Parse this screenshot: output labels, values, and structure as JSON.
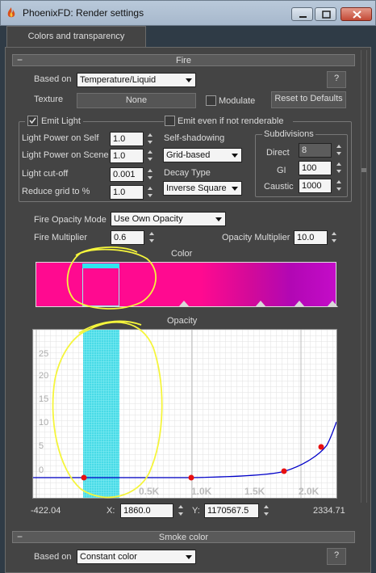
{
  "window": {
    "title": "PhoenixFD: Render settings",
    "app_icon": "phoenix-flame-icon"
  },
  "tabs": [
    {
      "label": "Colors and transparency",
      "active": true
    }
  ],
  "fire_rollout": {
    "header": "Fire",
    "collapse_symbol": "−",
    "based_on_label": "Based on",
    "based_on_value": "Temperature/Liquid",
    "help_label": "?",
    "texture_label": "Texture",
    "texture_value": "None",
    "modulate_label": "Modulate",
    "modulate_checked": false,
    "reset_label": "Reset to Defaults",
    "emit_light_label": "Emit Light",
    "emit_light_checked": true,
    "emit_not_renderable_label": "Emit even if not renderable",
    "emit_not_renderable_checked": false,
    "light_power_self_label": "Light Power on Self",
    "light_power_self_value": "1.0",
    "light_power_scene_label": "Light Power on Scene",
    "light_power_scene_value": "1.0",
    "light_cutoff_label": "Light cut-off",
    "light_cutoff_value": "0.001",
    "reduce_grid_label": "Reduce grid to %",
    "reduce_grid_value": "1.0",
    "self_shadowing_label": "Self-shadowing",
    "self_shadowing_value": "Grid-based",
    "decay_type_label": "Decay Type",
    "decay_type_value": "Inverse Square",
    "subdivisions": {
      "title": "Subdivisions",
      "direct_label": "Direct",
      "direct_value": "8",
      "gi_label": "GI",
      "gi_value": "100",
      "caustic_label": "Caustic",
      "caustic_value": "1000"
    },
    "fire_opacity_mode_label": "Fire Opacity Mode",
    "fire_opacity_mode_value": "Use Own Opacity",
    "fire_multiplier_label": "Fire Multiplier",
    "fire_multiplier_value": "0.6",
    "opacity_multiplier_label": "Opacity Multiplier",
    "opacity_multiplier_value": "10.0",
    "color_label": "Color",
    "color_gradient": {
      "colors": [
        "#ff0a90",
        "#ff0a90",
        "#d10a9a",
        "#b207b4",
        "#c40cc8"
      ],
      "selected_highlight": "#2ee6f0",
      "knot_color": "#d8d8d8"
    },
    "opacity_label": "Opacity",
    "opacity_curve": {
      "y_ticks": [
        "25",
        "20",
        "15",
        "10",
        "5",
        "0"
      ],
      "x_ticks": [
        "0.5K",
        "1.0K",
        "1.5K",
        "2.0K"
      ],
      "range_min": "-422.04",
      "range_max": "2334.71",
      "x_label": "X:",
      "x_value": "1860.0",
      "y_label": "Y:",
      "y_value": "1170567.5",
      "curve_color": "#0000c8",
      "point_color": "#e81010",
      "selection_color": "#2ee6f0"
    }
  },
  "smoke_color_rollout": {
    "header": "Smoke color",
    "collapse_symbol": "−",
    "based_on_label": "Based on",
    "based_on_value": "Constant color",
    "help_label": "?"
  },
  "annotation_color": "#f5f53c"
}
